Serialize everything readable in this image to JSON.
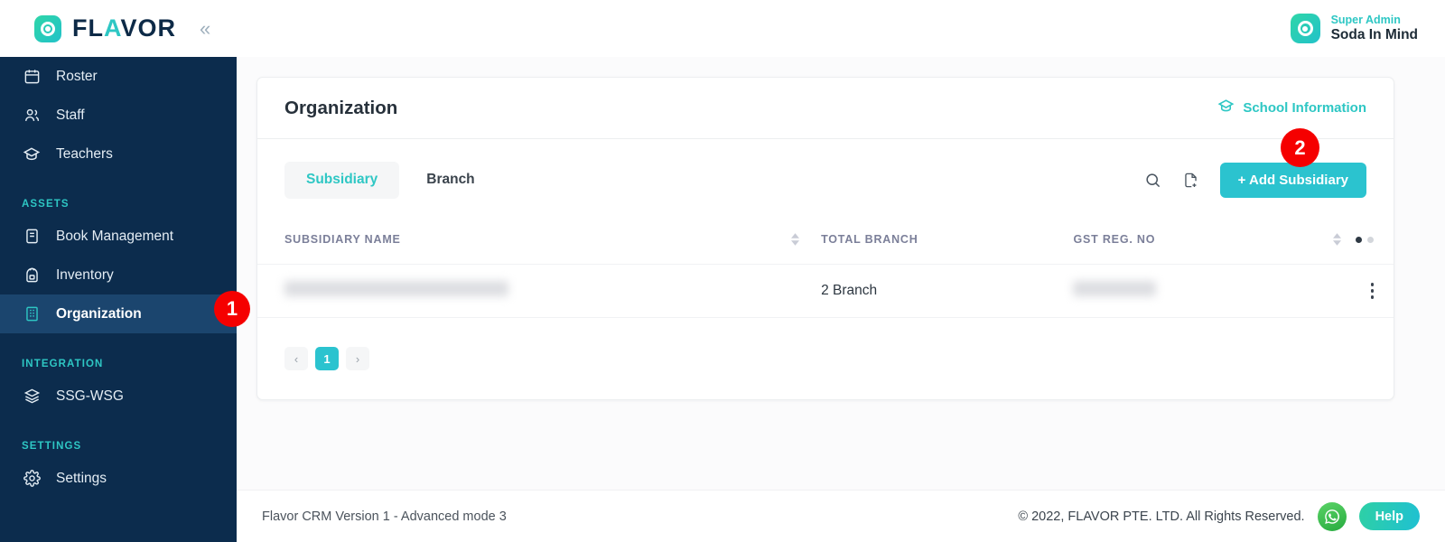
{
  "brand": {
    "name_dark_1": "FL",
    "name_accent": "A",
    "name_dark_2": "VOR",
    "collapse_icon": "chevrons-left-icon"
  },
  "user": {
    "role": "Super Admin",
    "name": "Soda In Mind"
  },
  "sidebar": {
    "items": [
      {
        "label": "Roster",
        "icon": "calendar-icon",
        "active": false
      },
      {
        "label": "Staff",
        "icon": "users-icon",
        "active": false
      },
      {
        "label": "Teachers",
        "icon": "graduation-cap-icon",
        "active": false
      }
    ],
    "sections": [
      {
        "title": "ASSETS",
        "items": [
          {
            "label": "Book Management",
            "icon": "book-icon",
            "active": false
          },
          {
            "label": "Inventory",
            "icon": "backpack-icon",
            "active": false
          },
          {
            "label": "Organization",
            "icon": "building-icon",
            "active": true
          }
        ]
      },
      {
        "title": "INTEGRATION",
        "items": [
          {
            "label": "SSG-WSG",
            "icon": "layers-icon",
            "active": false
          }
        ]
      },
      {
        "title": "SETTINGS",
        "items": [
          {
            "label": "Settings",
            "icon": "gear-icon",
            "active": false
          }
        ]
      }
    ]
  },
  "card": {
    "title": "Organization",
    "school_information_link": "School Information",
    "school_information_icon": "graduation-cap-icon",
    "tabs": [
      {
        "label": "Subsidiary",
        "active": true
      },
      {
        "label": "Branch",
        "active": false
      }
    ],
    "actions": {
      "search_icon": "search-icon",
      "export_icon": "file-add-icon",
      "add_button": "+ Add Subsidiary"
    },
    "table": {
      "columns": [
        "SUBSIDIARY NAME",
        "TOTAL BRANCH",
        "GST REG. NO"
      ],
      "rows": [
        {
          "subsidiary_name": "",
          "total_branch": "2 Branch",
          "gst_reg_no": ""
        }
      ]
    },
    "pagination": {
      "prev": "‹",
      "pages": [
        "1"
      ],
      "next": "›",
      "current": "1"
    }
  },
  "footer": {
    "version": "Flavor CRM Version 1 - Advanced mode 3",
    "copyright": "© 2022, FLAVOR PTE. LTD. All Rights Reserved.",
    "whatsapp_icon": "whatsapp-icon",
    "help_label": "Help"
  },
  "steps": [
    {
      "number": "1"
    },
    {
      "number": "2"
    }
  ],
  "colors": {
    "sidebar_bg": "#0c2c4d",
    "sidebar_active": "#1b456e",
    "accent": "#2ec7c4",
    "primary_button": "#2bc3cf",
    "step_badge": "#f50000"
  }
}
